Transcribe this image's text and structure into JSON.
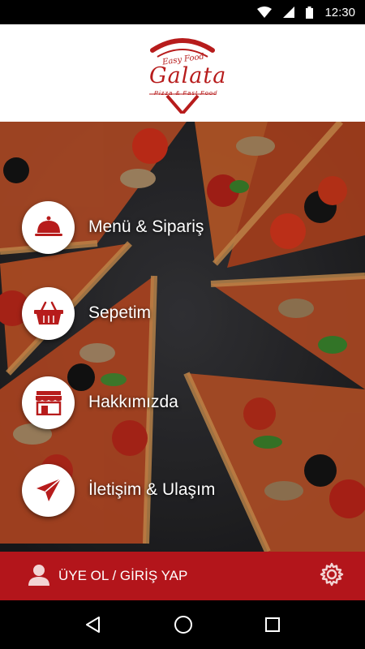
{
  "status_bar": {
    "time": "12:30"
  },
  "header": {
    "logo": {
      "tagline": "Easy Food",
      "name": "Galata",
      "subtitle": "Pizza & Fast Food"
    }
  },
  "menu": {
    "items": [
      {
        "label": "Menü & Sipariş",
        "icon": "cloche-icon"
      },
      {
        "label": "Sepetim",
        "icon": "basket-icon"
      },
      {
        "label": "Hakkımızda",
        "icon": "store-icon"
      },
      {
        "label": "İletişim & Ulaşım",
        "icon": "paper-plane-icon"
      }
    ]
  },
  "bottom_bar": {
    "login_label": "ÜYE OL / GİRİŞ YAP"
  },
  "colors": {
    "brand_red": "#b3151b",
    "icon_red": "#b71c1c"
  }
}
